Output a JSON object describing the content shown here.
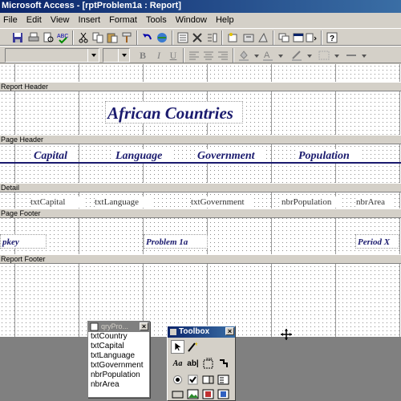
{
  "window": {
    "title": "Microsoft Access - [rptProblem1a : Report]"
  },
  "menu": [
    "File",
    "Edit",
    "View",
    "Insert",
    "Format",
    "Tools",
    "Window",
    "Help"
  ],
  "sections": {
    "report_header": "Report Header",
    "page_header": "Page Header",
    "detail": "Detail",
    "page_footer": "Page Footer",
    "report_footer": "Report Footer"
  },
  "report": {
    "title": "African Countries",
    "headers": [
      "Capital",
      "Language",
      "Government",
      "Population"
    ],
    "detail_fields": [
      "txtCapital",
      "txtLanguage",
      "txtGovernment",
      "nbrPopulation",
      "nbrArea"
    ],
    "footer_left": "pkey",
    "footer_center": "Problem 1a",
    "footer_right": "Period X"
  },
  "field_list": {
    "title": "qryPro...",
    "items": [
      "txtCountry",
      "txtCapital",
      "txtLanguage",
      "txtGovernment",
      "nbrPopulation",
      "nbrArea"
    ]
  },
  "toolbox": {
    "title": "Toolbox",
    "tools": [
      "select-icon",
      "wizard-icon",
      "label-icon",
      "textbox-icon",
      "option-group-icon",
      "toggle-icon",
      "option-button-icon",
      "checkbox-icon",
      "combo-icon",
      "listbox-icon",
      "command-button-icon",
      "image-icon",
      "unbound-frame-icon",
      "bound-frame-icon"
    ],
    "labels": {
      "label": "Aa",
      "textbox": "ab|"
    }
  },
  "colors": {
    "accent": "#1a1a6e",
    "titlebar": "#0a246a",
    "chrome": "#d4d0c8"
  }
}
